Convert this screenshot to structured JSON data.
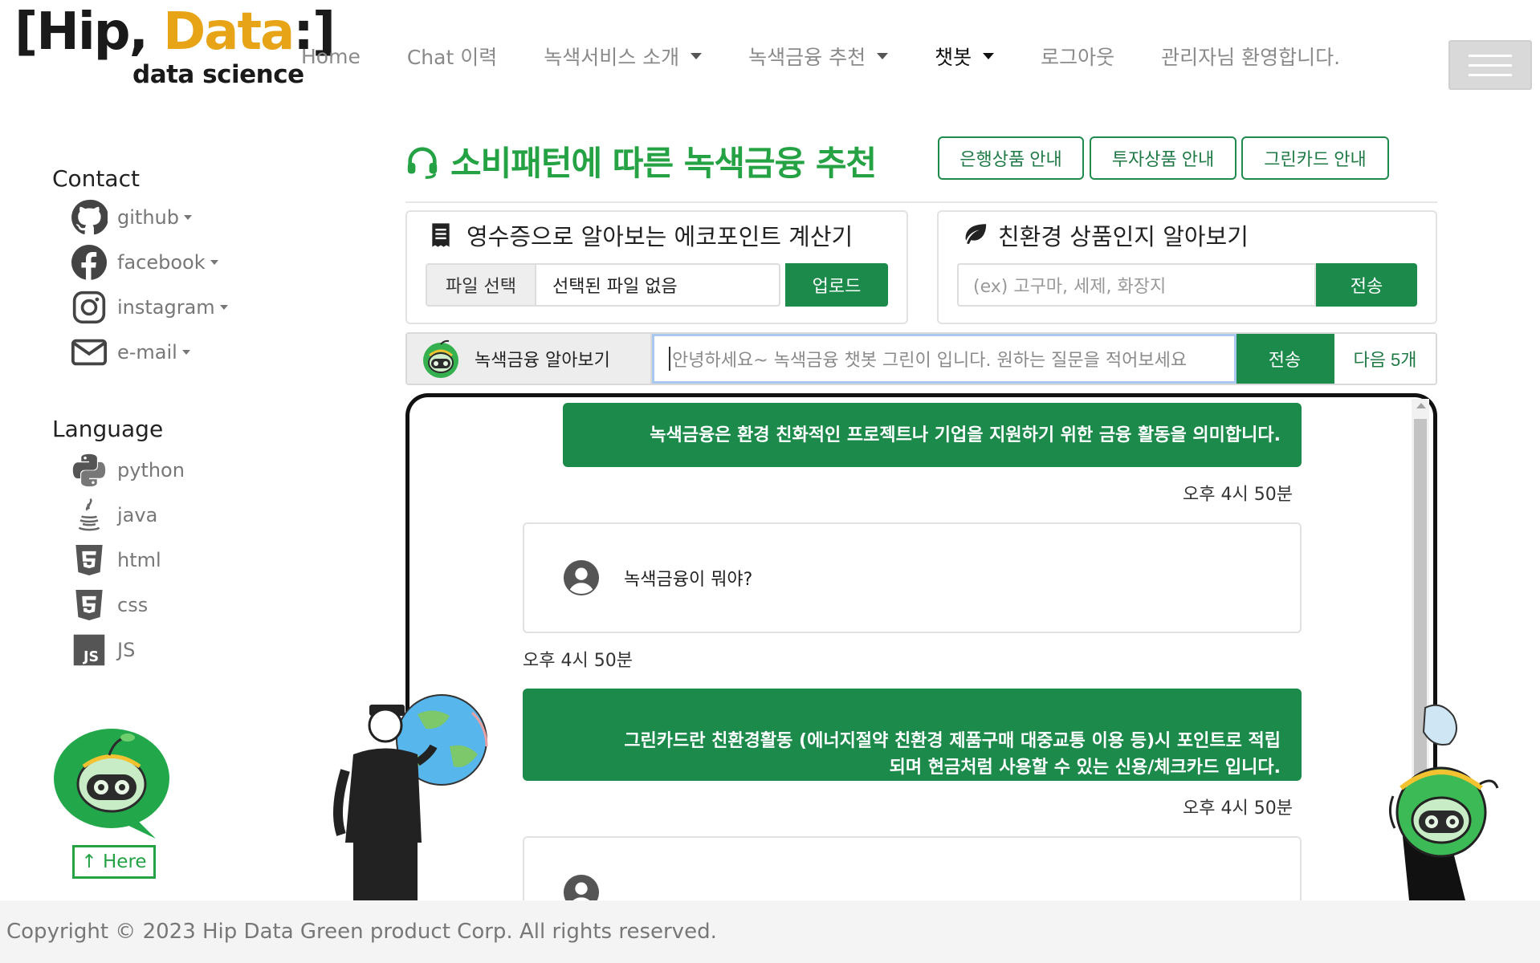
{
  "logo": {
    "main_prefix": "[Hip, ",
    "main_accent": "Data",
    "main_suffix": ":]",
    "sub": "data science"
  },
  "nav": {
    "home": "Home",
    "chat_history": "Chat 이력",
    "green_service": "녹색서비스 소개",
    "green_finance": "녹색금융 추천",
    "chatbot": "챗봇",
    "logout": "로그아웃",
    "welcome": "관리자님 환영합니다."
  },
  "sidebar": {
    "contact_title": "Contact",
    "contact": [
      {
        "label": "github",
        "icon": "github-icon"
      },
      {
        "label": "facebook",
        "icon": "facebook-icon"
      },
      {
        "label": "instagram",
        "icon": "instagram-icon"
      },
      {
        "label": "e-mail",
        "icon": "mail-icon"
      }
    ],
    "language_title": "Language",
    "languages": [
      {
        "label": "python",
        "icon": "python-icon"
      },
      {
        "label": "java",
        "icon": "java-icon"
      },
      {
        "label": "html",
        "icon": "html5-icon"
      },
      {
        "label": "css",
        "icon": "css3-icon"
      },
      {
        "label": "JS",
        "icon": "js-icon"
      }
    ],
    "here_button": "↑ Here"
  },
  "page": {
    "title": "소비패턴에 따른 녹색금융 추천",
    "buttons": {
      "bank": "은행상품 안내",
      "invest": "투자상품 안내",
      "greencard": "그린카드 안내"
    }
  },
  "receipt_card": {
    "title": "영수증으로 알아보는 에코포인트 계산기",
    "file_button": "파일 선택",
    "file_status": "선택된 파일 없음",
    "upload": "업로드"
  },
  "eco_card": {
    "title": "친환경 상품인지 알아보기",
    "placeholder": "(ex) 고구마, 세제, 화장지",
    "send": "전송"
  },
  "chat_query": {
    "label": "녹색금융 알아보기",
    "placeholder": "안녕하세요~ 녹색금융 챗봇 그린이 입니다. 원하는 질문을 적어보세요",
    "send": "전송",
    "next": "다음 5개"
  },
  "messages": {
    "bot1": "녹색금융은 환경 친화적인 프로젝트나 기업을 지원하기 위한 금융 활동을 의미합니다.",
    "bot1_time": "오후 4시 50분",
    "user1": "녹색금융이 뭐야?",
    "user1_time": "오후 4시 50분",
    "bot2_line1": "그린카드란 친환경활동 (에너지절약 친환경 제품구매 대중교통 이용 등)시 포인트로 적립",
    "bot2_line2": "되며 현금처럼 사용할 수 있는 신용/체크카드 입니다.",
    "bot2_time": "오후 4시 50분"
  },
  "footer": {
    "copyright": "Copyright © 2023 Hip Data Green product Corp. All rights reserved."
  },
  "colors": {
    "green": "#1b8a4b",
    "title_green": "#24a244",
    "logo_accent": "#e8a417"
  }
}
